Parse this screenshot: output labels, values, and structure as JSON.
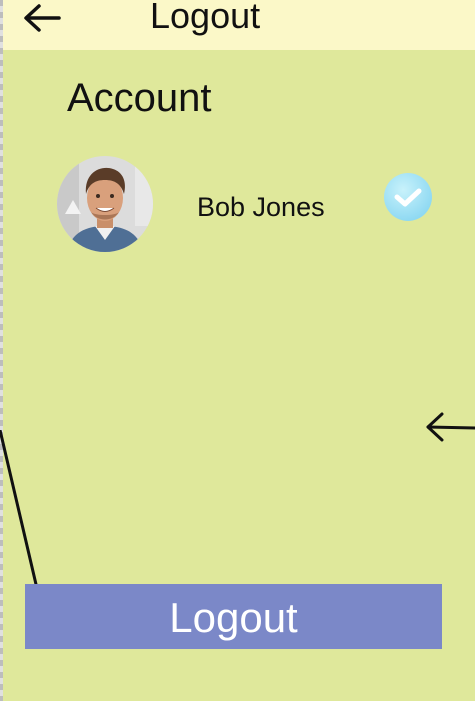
{
  "header": {
    "title": "Logout",
    "back_icon": "arrow-left-icon"
  },
  "account": {
    "section_title": "Account",
    "user_name": "Bob Jones",
    "verified_icon": "check-circle-icon"
  },
  "annotation": {
    "arrow_icon": "arrow-left-icon"
  },
  "actions": {
    "logout_label": "Logout"
  },
  "colors": {
    "background": "#dfe89b",
    "header": "#fbf8c8",
    "logout_button": "#7b88c8",
    "badge": "#a9e6f7"
  }
}
